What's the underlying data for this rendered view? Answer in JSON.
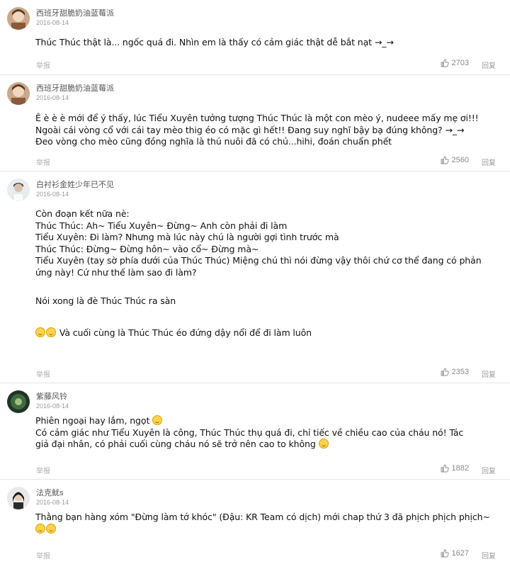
{
  "comments": [
    {
      "username": "西班牙甜脆奶油蓝莓派",
      "date": "2016-08-14",
      "avatar_icon": "avatar-photo-icon",
      "body": [
        "Thúc Thúc thật là... ngốc quá đi. Nhìn em là thấy có cảm giác thật dễ bắt nạt →_→"
      ],
      "report": "举报",
      "likes": "2703",
      "reply": "回复"
    },
    {
      "username": "西班牙甜脆奶油蓝莓派",
      "date": "2016-08-14",
      "avatar_icon": "avatar-photo-icon",
      "body": [
        "Ê è è è mới để ý thấy, lúc Tiểu Xuyên tưởng tượng Thúc Thúc là một con mèo ý, nudeee mấy mẹ ơi!!!",
        "Ngoài cái vòng cổ với cái tay mèo thig éo có mặc gì hết!! Đang suy nghĩ bậy bạ đúng không? →_→",
        "Đeo vòng cho mèo cũng đồng nghĩa là thú nuôi đã có chủ...hihi, đoán chuẩn phết"
      ],
      "report": "举报",
      "likes": "2560",
      "reply": "回复"
    },
    {
      "username": "白衬衫金姓少年已不见",
      "date": "2016-08-14",
      "avatar_icon": "avatar-photo-icon",
      "body": [
        "Còn đoạn kết nữa nè:",
        "Thúc Thúc: Ah~ Tiểu Xuyên~ Đừng~ Anh còn phải đi làm",
        "Tiểu Xuyên: Đi làm? Nhưng mà lúc này chú là người gợi tình trước mà",
        "Thúc Thúc: Đừng~ Đừng hôn~ vào cổ~ Đừng mà~",
        "Tiểu Xuyên (tay sờ phía dưới của Thúc Thúc) Miệng chú thì nói đừng vậy thôi chứ cơ thể đang có phản",
        "ứng này! Cứ như thế làm sao đi làm?",
        "",
        "Nói xong là đè Thúc Thúc ra sàn",
        "",
        "Và cuối cùng là Thúc Thúc éo đứng dậy nổi để đi làm luôn"
      ],
      "report": "举报",
      "likes": "2353",
      "reply": "回复"
    },
    {
      "username": "紫藤风铃",
      "date": "2016-08-14",
      "avatar_icon": "avatar-photo-icon",
      "body": [
        "Phiên ngoại hay lắm, ngọt",
        "Có cảm giác như Tiểu Xuyên là công, Thúc Thúc thụ quá đi, chỉ tiếc về chiều cao của cháu nó! Tác",
        "giả đại nhân, có phải cuối cùng cháu nó sẽ trở nên cao to không"
      ],
      "report": "举报",
      "likes": "1882",
      "reply": "回复"
    },
    {
      "username": "法克鱿s",
      "date": "2016-08-14",
      "avatar_icon": "avatar-photo-icon",
      "body": [
        "Thằng bạn hàng xóm \"Đừng làm tớ khóc\" (Đậu: KR Team có dịch) mới chap thứ 3 đã phịch phịch phịch~"
      ],
      "report": "举报",
      "likes": "1627",
      "reply": "回复"
    }
  ],
  "colors": {
    "text": "#111111",
    "meta": "#999999",
    "divider": "#e6e6e6",
    "emoji": "#ffd34d"
  }
}
